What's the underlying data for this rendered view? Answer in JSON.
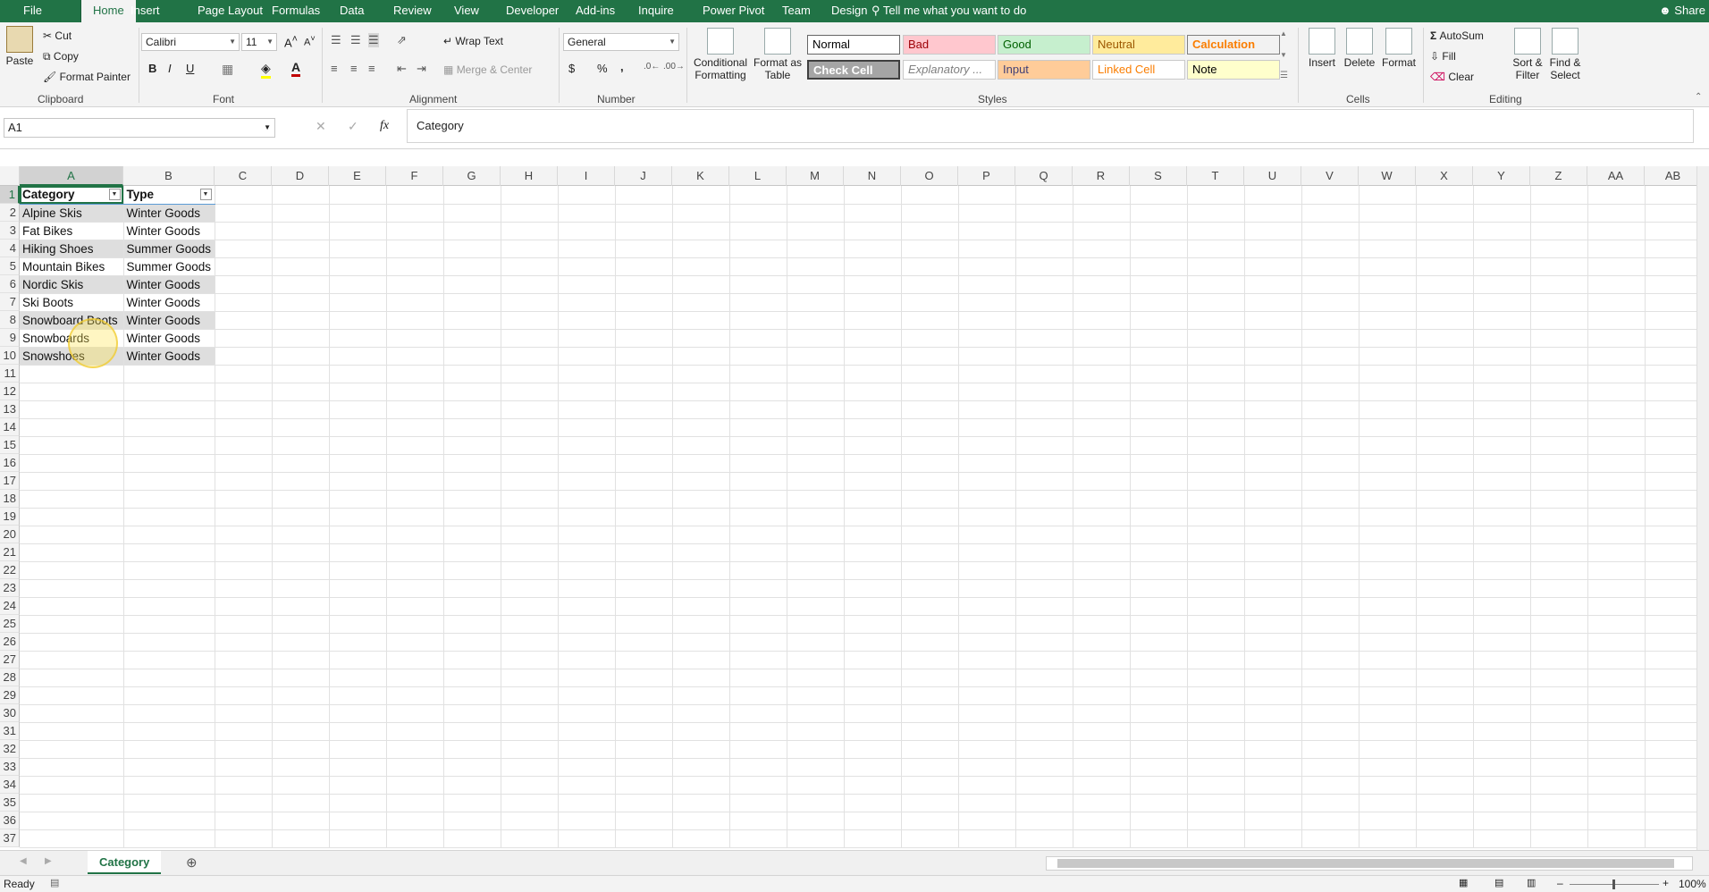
{
  "tabs": [
    "File",
    "Home",
    "Insert",
    "Page Layout",
    "Formulas",
    "Data",
    "Review",
    "View",
    "Developer",
    "Add-ins",
    "Inquire",
    "Power Pivot",
    "Team",
    "Design"
  ],
  "active_tab": "Home",
  "tell_me": "Tell me what you want to do",
  "share": "Share",
  "clipboard": {
    "paste": "Paste",
    "cut": "Cut",
    "copy": "Copy",
    "format_painter": "Format Painter",
    "label": "Clipboard"
  },
  "font": {
    "name": "Calibri",
    "size": "11",
    "label": "Font",
    "bold": "B",
    "italic": "I",
    "underline": "U"
  },
  "alignment": {
    "wrap": "Wrap Text",
    "merge": "Merge & Center",
    "label": "Alignment"
  },
  "number": {
    "format": "General",
    "label": "Number",
    "currency": "$",
    "percent": "%",
    "comma": ","
  },
  "styles": {
    "conditional": "Conditional Formatting",
    "format_table": "Format as Table",
    "label": "Styles",
    "items": [
      {
        "name": "Normal",
        "bg": "#ffffff",
        "fg": "#000000"
      },
      {
        "name": "Bad",
        "bg": "#ffc7ce",
        "fg": "#9c0006"
      },
      {
        "name": "Good",
        "bg": "#c6efce",
        "fg": "#006100"
      },
      {
        "name": "Neutral",
        "bg": "#ffeb9c",
        "fg": "#9c5700"
      },
      {
        "name": "Calculation",
        "bg": "#f2f2f2",
        "fg": "#fa7d00"
      },
      {
        "name": "Check Cell",
        "bg": "#a5a5a5",
        "fg": "#ffffff"
      },
      {
        "name": "Explanatory ...",
        "bg": "#ffffff",
        "fg": "#7f7f7f"
      },
      {
        "name": "Input",
        "bg": "#ffcc99",
        "fg": "#3f3f76"
      },
      {
        "name": "Linked Cell",
        "bg": "#ffffff",
        "fg": "#fa7d00"
      },
      {
        "name": "Note",
        "bg": "#ffffcc",
        "fg": "#000000"
      }
    ]
  },
  "cells_group": {
    "insert": "Insert",
    "delete": "Delete",
    "format": "Format",
    "label": "Cells"
  },
  "editing": {
    "autosum": "AutoSum",
    "fill": "Fill",
    "clear": "Clear",
    "sort": "Sort & Filter",
    "find": "Find & Select",
    "label": "Editing"
  },
  "namebox": "A1",
  "fx": "fx",
  "formula": "Category",
  "columns": [
    "A",
    "B",
    "C",
    "D",
    "E",
    "F",
    "G",
    "H",
    "I",
    "J",
    "K",
    "L",
    "M",
    "N",
    "O",
    "P",
    "Q",
    "R",
    "S",
    "T",
    "U",
    "V",
    "W",
    "X",
    "Y",
    "Z",
    "AA",
    "AB"
  ],
  "rows": [
    [
      "Category",
      "Type"
    ],
    [
      "Alpine Skis",
      "Winter Goods"
    ],
    [
      "Fat Bikes",
      "Winter Goods"
    ],
    [
      "Hiking Shoes",
      "Summer Goods"
    ],
    [
      "Mountain Bikes",
      "Summer Goods"
    ],
    [
      "Nordic Skis",
      "Winter Goods"
    ],
    [
      "Ski Boots",
      "Winter Goods"
    ],
    [
      "Snowboard Boots",
      "Winter Goods"
    ],
    [
      "Snowboards",
      "Winter Goods"
    ],
    [
      "Snowshoes",
      "Winter Goods"
    ]
  ],
  "row_count": 37,
  "sheet": "Category",
  "status": "Ready",
  "zoom": "100%"
}
